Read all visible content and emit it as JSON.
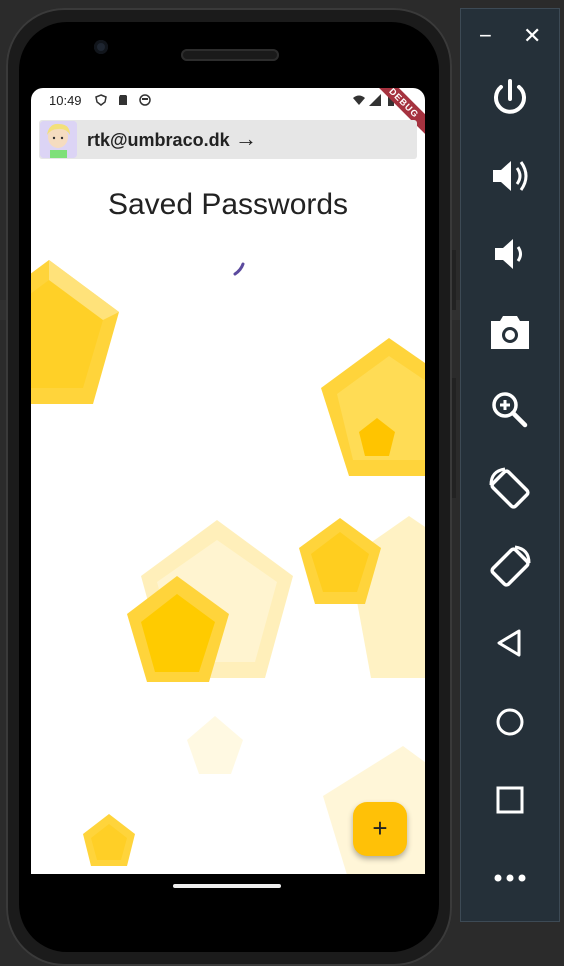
{
  "status_bar": {
    "time": "10:49",
    "debug_banner": "DEBUG"
  },
  "account_bar": {
    "email": "rtk@umbraco.dk",
    "arrow": "→"
  },
  "page": {
    "title": "Saved Passwords"
  },
  "fab": {
    "label": "+"
  },
  "emulator_toolbar": {
    "minimize": "−",
    "close": "✕",
    "buttons": [
      "power-icon",
      "volume-up-icon",
      "volume-down-icon",
      "camera-icon",
      "zoom-icon",
      "rotate-left-icon",
      "rotate-right-icon",
      "back-icon",
      "home-icon",
      "overview-icon",
      "more-icon"
    ]
  },
  "colors": {
    "gem": "#ffd43b",
    "fab": "#ffc107",
    "toolbar": "#253039",
    "spinner": "#5b4a9e"
  }
}
